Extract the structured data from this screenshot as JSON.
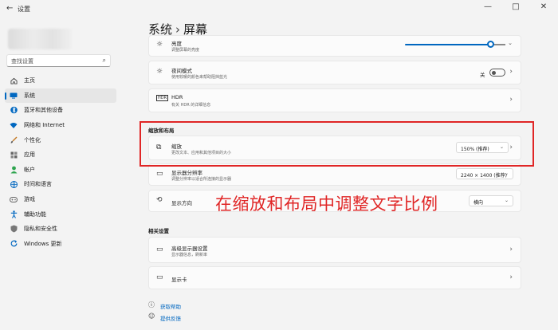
{
  "window": {
    "title": "设置",
    "controls": [
      "—",
      "□",
      "✕"
    ]
  },
  "sidebar": {
    "search_placeholder": "查找设置",
    "items": [
      {
        "label": "主页",
        "icon": "home-icon",
        "color": "#444444",
        "active": false
      },
      {
        "label": "系统",
        "icon": "system-icon",
        "color": "#0067c0",
        "active": true
      },
      {
        "label": "蓝牙和其他设备",
        "icon": "bluetooth-icon",
        "color": "#0067c0",
        "active": false
      },
      {
        "label": "网络和 Internet",
        "icon": "wifi-icon",
        "color": "#0067c0",
        "active": false
      },
      {
        "label": "个性化",
        "icon": "brush-icon",
        "color": "#c47a26",
        "active": false
      },
      {
        "label": "应用",
        "icon": "apps-icon",
        "color": "#555555",
        "active": false
      },
      {
        "label": "帐户",
        "icon": "account-icon",
        "color": "#2da44e",
        "active": false
      },
      {
        "label": "时间和语言",
        "icon": "globe-icon",
        "color": "#0067c0",
        "active": false
      },
      {
        "label": "游戏",
        "icon": "gamepad-icon",
        "color": "#666666",
        "active": false
      },
      {
        "label": "辅助功能",
        "icon": "accessibility-icon",
        "color": "#0067c0",
        "active": false
      },
      {
        "label": "隐私和安全性",
        "icon": "shield-icon",
        "color": "#666666",
        "active": false
      },
      {
        "label": "Windows 更新",
        "icon": "update-icon",
        "color": "#0067c0",
        "active": false
      }
    ]
  },
  "header": {
    "crumb_parent": "系统",
    "separator": "›",
    "crumb_current": "屏幕"
  },
  "brightness": {
    "title": "亮度",
    "subtitle": "调整屏幕的亮度",
    "level_percent": 86
  },
  "night_light": {
    "title": "夜间模式",
    "subtitle": "使用较暖的颜色来帮助阻挡蓝光",
    "state": "关"
  },
  "hdr": {
    "title": "HDR",
    "subtitle": "有关 HDR 的详细信息"
  },
  "scale_layout": {
    "section_label": "缩放和布局",
    "scale": {
      "title": "缩放",
      "subtitle": "更改文本、应用和其他项目的大小",
      "value": "150% (推荐)"
    },
    "resolution": {
      "title": "显示器分辨率",
      "subtitle": "调整分辨率以适合所连接的显示器",
      "value": "2240 × 1400 (推荐)"
    },
    "orientation": {
      "title": "显示方向",
      "value": "横向"
    }
  },
  "related": {
    "section_label": "相关设置",
    "advanced": {
      "title": "高级显示器设置",
      "subtitle": "显示器信息，刷新率"
    },
    "graphics": {
      "title": "显示卡"
    }
  },
  "help": {
    "get_help": "获取帮助",
    "feedback": "提供反馈"
  },
  "annotation": {
    "text": "在缩放和布局中调整文字比例",
    "color": "#e02626"
  }
}
